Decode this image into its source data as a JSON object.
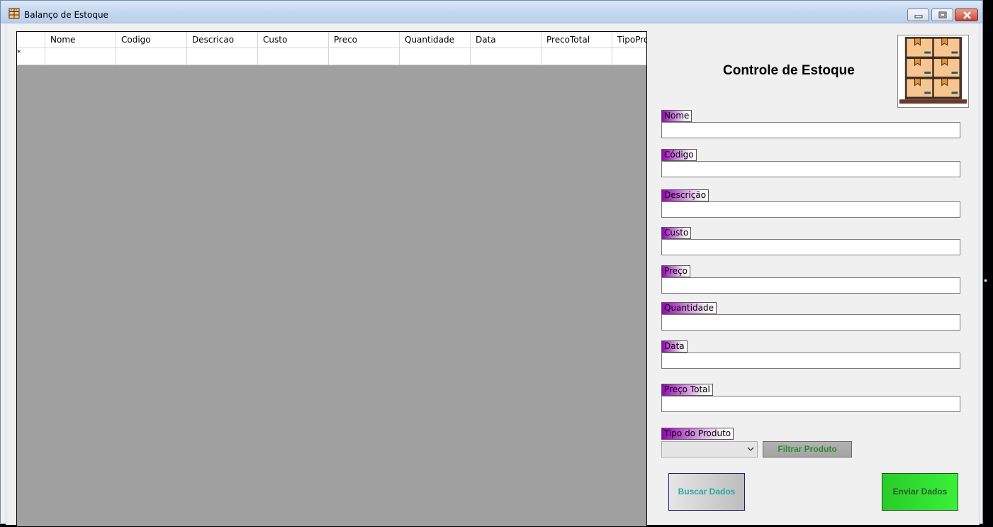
{
  "window": {
    "title": "Balanço de Estoque"
  },
  "grid": {
    "columns": [
      "Nome",
      "Codigo",
      "Descricao",
      "Custo",
      "Preco",
      "Quantidade",
      "Data",
      "PrecoTotal",
      "TipoPro"
    ],
    "new_row_marker": "*"
  },
  "panel": {
    "title": "Controle de Estoque",
    "fields": {
      "nome": "Nome",
      "codigo": "Código",
      "descricao": "Descrição",
      "custo": "Custo",
      "preco": "Preço",
      "quantidade": "Quantidade",
      "data": "Data",
      "preco_total": "Preço Total",
      "tipo_produto": "Tipo do Produto"
    },
    "tipo_produto_selected": "",
    "buttons": {
      "filtrar": "Filtrar Produto",
      "buscar": "Buscar Dados",
      "enviar": "Enviar Dados"
    }
  },
  "icons": {
    "app": "shelf-boxes-icon",
    "logo": "warehouse-shelf-logo"
  }
}
